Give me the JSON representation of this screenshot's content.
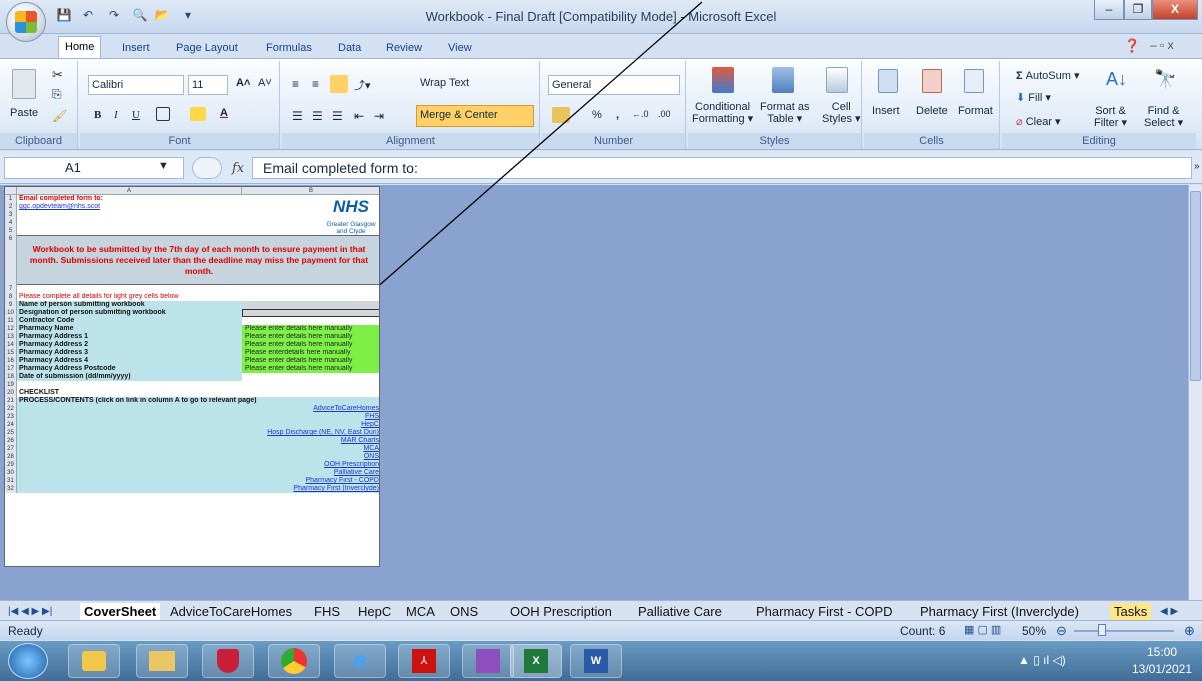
{
  "window": {
    "title": "Workbook - Final Draft  [Compatibility Mode] - Microsoft Excel",
    "minimize": "–",
    "restore": "❐",
    "close": "X"
  },
  "tabs": [
    "Home",
    "Insert",
    "Page Layout",
    "Formulas",
    "Data",
    "Review",
    "View"
  ],
  "ribbon": {
    "clipboard": {
      "label": "Clipboard",
      "paste": "Paste"
    },
    "font": {
      "label": "Font",
      "name": "Calibri",
      "size": "11",
      "bold": "B",
      "italic": "I",
      "underline": "U",
      "grow": "A˄",
      "shrink": "A˅",
      "color": "A"
    },
    "alignment": {
      "label": "Alignment",
      "wrap": "Wrap Text",
      "merge": "Merge & Center"
    },
    "number": {
      "label": "Number",
      "format": "General",
      "percent": "%",
      "comma": ","
    },
    "styles": {
      "label": "Styles",
      "conditional": "Conditional",
      "conditional2": "Formatting",
      "format_as": "Format as",
      "format_as2": "Table",
      "cell": "Cell",
      "cell2": "Styles"
    },
    "cells": {
      "label": "Cells",
      "insert": "Insert",
      "delete": "Delete",
      "format": "Format"
    },
    "editing": {
      "label": "Editing",
      "autosum": "AutoSum",
      "fill": "Fill",
      "clear": "Clear",
      "sort": "Sort &",
      "sort2": "Filter",
      "find": "Find &",
      "find2": "Select"
    }
  },
  "formula_bar": {
    "cell": "A1",
    "fx": "fx",
    "content": "Email completed form to:"
  },
  "sheet": {
    "col_a": "A",
    "col_b": "B",
    "email_label": "Email completed form to:",
    "email_address": "ggc.opdevteam@nhs.scot",
    "nhs_logo": "NHS",
    "nhs_sub1": "Greater Glasgow",
    "nhs_sub2": "and Clyde",
    "notice": "Workbook to be submitted by the 7th day of each month to ensure payment in that month. Submissions received later than the deadline may miss the payment for that month.",
    "instruction": "Please complete all details for light grey cells below",
    "fields": [
      {
        "row": "9",
        "label": "Name of person submitting workbook",
        "value": "",
        "style": "grey"
      },
      {
        "row": "10",
        "label": "Designation of person submitting workbook",
        "value": "",
        "style": "grey"
      },
      {
        "row": "11",
        "label": "Contractor Code",
        "value": "",
        "style": "white"
      },
      {
        "row": "12",
        "label": "Pharmacy Name",
        "value": "Please enter details here manually",
        "style": "green"
      },
      {
        "row": "13",
        "label": "Pharmacy Address 1",
        "value": "Please enter details here manually",
        "style": "green"
      },
      {
        "row": "14",
        "label": "Pharmacy Address 2",
        "value": "Please enter details here manually",
        "style": "green"
      },
      {
        "row": "15",
        "label": "Pharmacy Address 3",
        "value": "Please enterdetails  here manually",
        "style": "green"
      },
      {
        "row": "16",
        "label": "Pharmacy Address 4",
        "value": "Please enter details here manually",
        "style": "green"
      },
      {
        "row": "17",
        "label": "Pharmacy Address Postcode",
        "value": "Please enter details here manually",
        "style": "green"
      },
      {
        "row": "18",
        "label": "Date of submission (dd/mm/yyyy)",
        "value": "",
        "style": "white"
      }
    ],
    "checklist": "CHECKLIST",
    "process_header": "PROCESS/CONTENTS (click on link in column A to go to relevant page)",
    "links": [
      {
        "row": "22",
        "label": "AdviceToCareHomes"
      },
      {
        "row": "23",
        "label": "FHS"
      },
      {
        "row": "24",
        "label": "HepC"
      },
      {
        "row": "25",
        "label": "Hosp Discharge (NE, NV, East Dun)"
      },
      {
        "row": "26",
        "label": "MAR Charts"
      },
      {
        "row": "27",
        "label": "MCA"
      },
      {
        "row": "28",
        "label": "ONS"
      },
      {
        "row": "29",
        "label": "OOH Prescription"
      },
      {
        "row": "30",
        "label": "Palliative Care"
      },
      {
        "row": "31",
        "label": "Pharmacy First - COPD"
      },
      {
        "row": "32",
        "label": "Pharmacy First (Inverclyde)"
      }
    ]
  },
  "sheet_tabs": [
    "CoverSheet",
    "AdviceToCareHomes",
    "FHS",
    "HepC",
    "MCA",
    "ONS",
    "OOH Prescription",
    "Palliative Care",
    "Pharmacy First - COPD",
    "Pharmacy First (Inverclyde)",
    "Tasks"
  ],
  "status": {
    "ready": "Ready",
    "count": "Count: 6",
    "zoom": "50%"
  },
  "clock": {
    "time": "15:00",
    "date": "13/01/2021"
  },
  "colors": {
    "excel_green": "#1d7a3a",
    "workspace": "#8aa2cf",
    "link": "#1b34d6",
    "red_text": "#e00000",
    "green_cell": "#7cf046",
    "teal_cell": "#bde3ea"
  }
}
